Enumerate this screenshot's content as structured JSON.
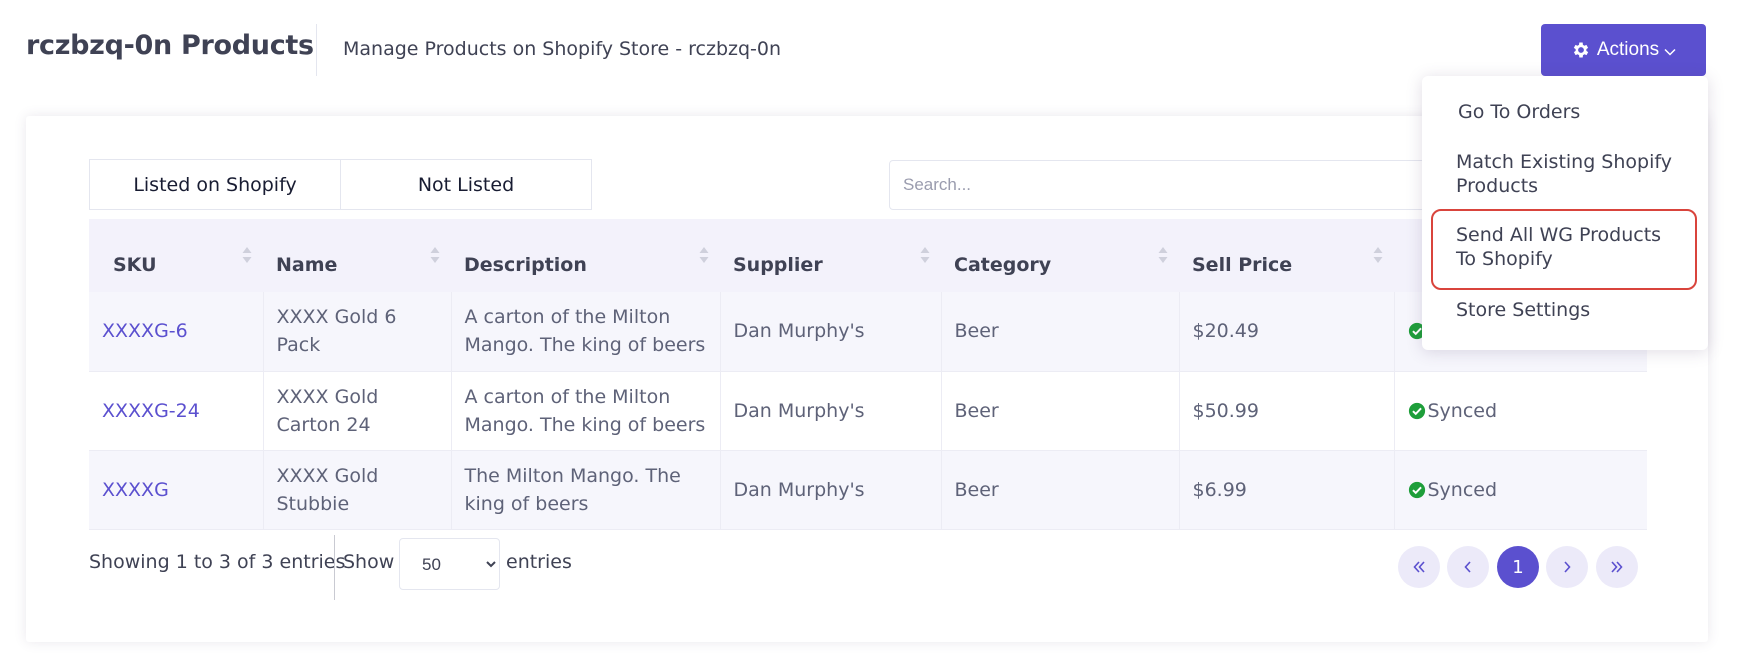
{
  "header": {
    "title": "rczbzq-0n Products",
    "subtitle": "Manage Products on Shopify Store - rczbzq-0n"
  },
  "actions": {
    "label": "Actions",
    "accent_color": "#5b50cf",
    "menu": [
      {
        "label": "Go To Orders"
      },
      {
        "label": "Match Existing Shopify Products"
      },
      {
        "label": "Send All WG Products To Shopify",
        "highlighted": true
      },
      {
        "label": "Store Settings"
      }
    ]
  },
  "filters": {
    "tabs": [
      {
        "label": "Listed on Shopify"
      },
      {
        "label": "Not Listed"
      }
    ]
  },
  "search": {
    "placeholder": "Search...",
    "value": ""
  },
  "table": {
    "columns": [
      "SKU",
      "Name",
      "Description",
      "Supplier",
      "Category",
      "Sell Price",
      ""
    ],
    "rows": [
      {
        "sku": "XXXXG-6",
        "name": "XXXX Gold 6 Pack",
        "description": "A carton of the Milton Mango. The king of beers",
        "supplier": "Dan Murphy's",
        "category": "Beer",
        "price": "$20.49",
        "status": ""
      },
      {
        "sku": "XXXXG-24",
        "name": "XXXX Gold Carton 24",
        "description": "A carton of the Milton Mango. The king of beers",
        "supplier": "Dan Murphy's",
        "category": "Beer",
        "price": "$50.99",
        "status": "Synced"
      },
      {
        "sku": "XXXXG",
        "name": "XXXX Gold Stubbie",
        "description": "The Milton Mango. The king of beers",
        "supplier": "Dan Murphy's",
        "category": "Beer",
        "price": "$6.99",
        "status": "Synced"
      }
    ]
  },
  "footer": {
    "showing": "Showing 1 to 3 of 3 entries",
    "show_label": "Show",
    "page_size": "50",
    "entries_label": "entries",
    "current_page": "1"
  },
  "icons": {
    "actions": "gear-icon",
    "status": "check-circle-icon",
    "sort": "sort-icon",
    "pager": [
      "double-chevron-left-icon",
      "chevron-left-icon",
      "chevron-right-icon",
      "double-chevron-right-icon"
    ]
  },
  "colors": {
    "status_green": "#1e9e3a",
    "highlight_red": "#d9443c"
  }
}
